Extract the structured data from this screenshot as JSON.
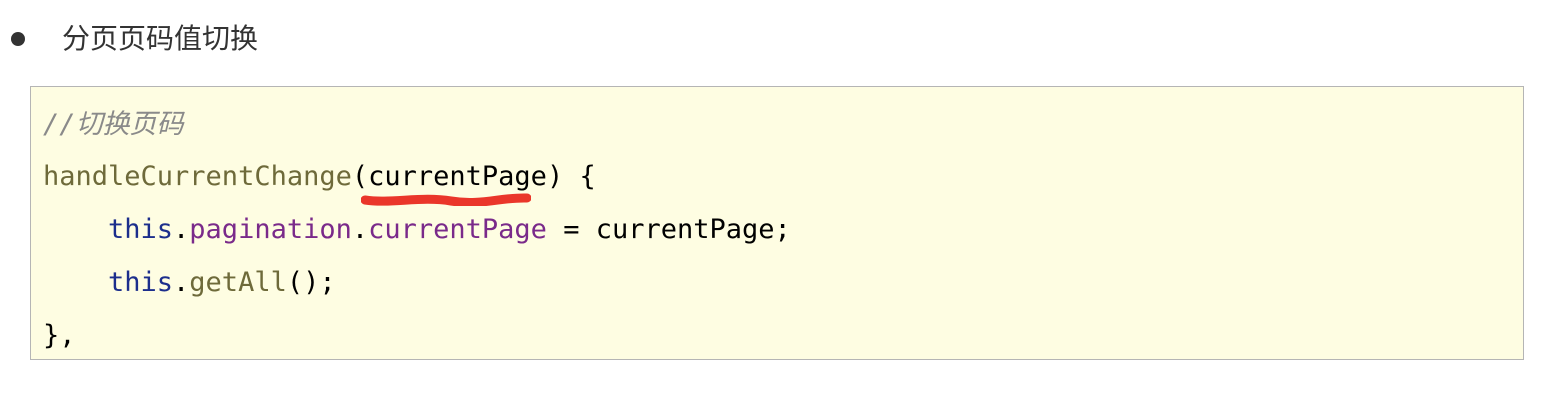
{
  "bullet": {
    "text": "分页页码值切换"
  },
  "code": {
    "line1": {
      "comment": "//切换页码"
    },
    "line2": {
      "func": "handleCurrentChange",
      "open_paren": "(",
      "param": "currentPage",
      "rest": ") {"
    },
    "line3": {
      "kw": "this",
      "dot1": ".",
      "prop1": "pagination",
      "dot2": ".",
      "prop2": "currentPage",
      "rest": " = currentPage;"
    },
    "line4": {
      "kw": "this",
      "dot1": ".",
      "method": "getAll",
      "rest": "();"
    },
    "line5": {
      "text": "},"
    }
  },
  "colors": {
    "code_background": "#fefde2",
    "code_border": "#b5b5b5",
    "comment": "#8a8a8a",
    "function": "#6e6a3a",
    "keyword": "#1c2e8c",
    "property": "#7a2a8a",
    "highlight_mark": "#e8251a"
  }
}
